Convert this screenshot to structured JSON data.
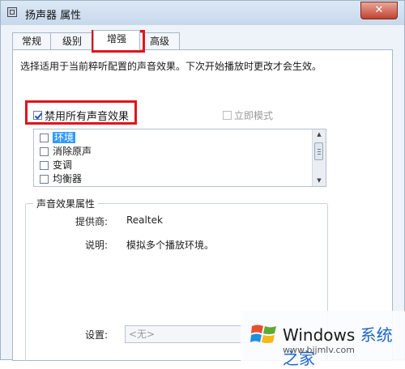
{
  "window": {
    "title": "扬声器 属性",
    "close_label": "✕"
  },
  "tabs": [
    {
      "label": "常规"
    },
    {
      "label": "级别"
    },
    {
      "label": "增强"
    },
    {
      "label": "高级"
    }
  ],
  "active_tab": "增强",
  "description": "选择适用于当前粹听配置的声音效果。下次开始播放时更改才会生效。",
  "disable_all": {
    "label": "禁用所有声音效果",
    "checked": true
  },
  "immediate_mode": {
    "label": "立即模式",
    "checked": false,
    "enabled": false
  },
  "effects": [
    {
      "label": "环境",
      "checked": false,
      "selected": true
    },
    {
      "label": "消除原声",
      "checked": false
    },
    {
      "label": "变调",
      "checked": false
    },
    {
      "label": "均衡器",
      "checked": false
    }
  ],
  "effect_properties": {
    "group_title": "声音效果属性",
    "provider_label": "提供商:",
    "provider_value": "Realtek",
    "description_label": "说明:",
    "description_value": "模拟多个播放环境。",
    "settings_label": "设置:",
    "settings_value": "<无>"
  },
  "watermark": {
    "title_prefix": "Windows",
    "title_suffix": "系统之家",
    "url": "www.bjjmlv.com"
  },
  "highlight_color": "#e0141c"
}
